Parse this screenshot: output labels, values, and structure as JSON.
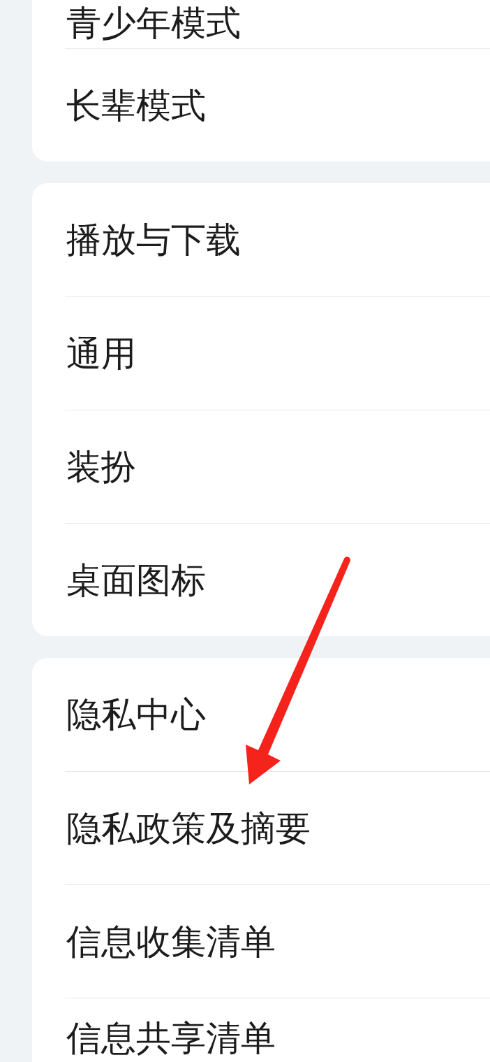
{
  "sections": [
    {
      "items": [
        {
          "label": "青少年模式"
        },
        {
          "label": "长辈模式"
        }
      ]
    },
    {
      "items": [
        {
          "label": "播放与下载"
        },
        {
          "label": "通用"
        },
        {
          "label": "装扮"
        },
        {
          "label": "桌面图标"
        }
      ]
    },
    {
      "items": [
        {
          "label": "隐私中心"
        },
        {
          "label": "隐私政策及摘要"
        },
        {
          "label": "信息收集清单"
        },
        {
          "label": "信息共享清单"
        }
      ]
    }
  ]
}
